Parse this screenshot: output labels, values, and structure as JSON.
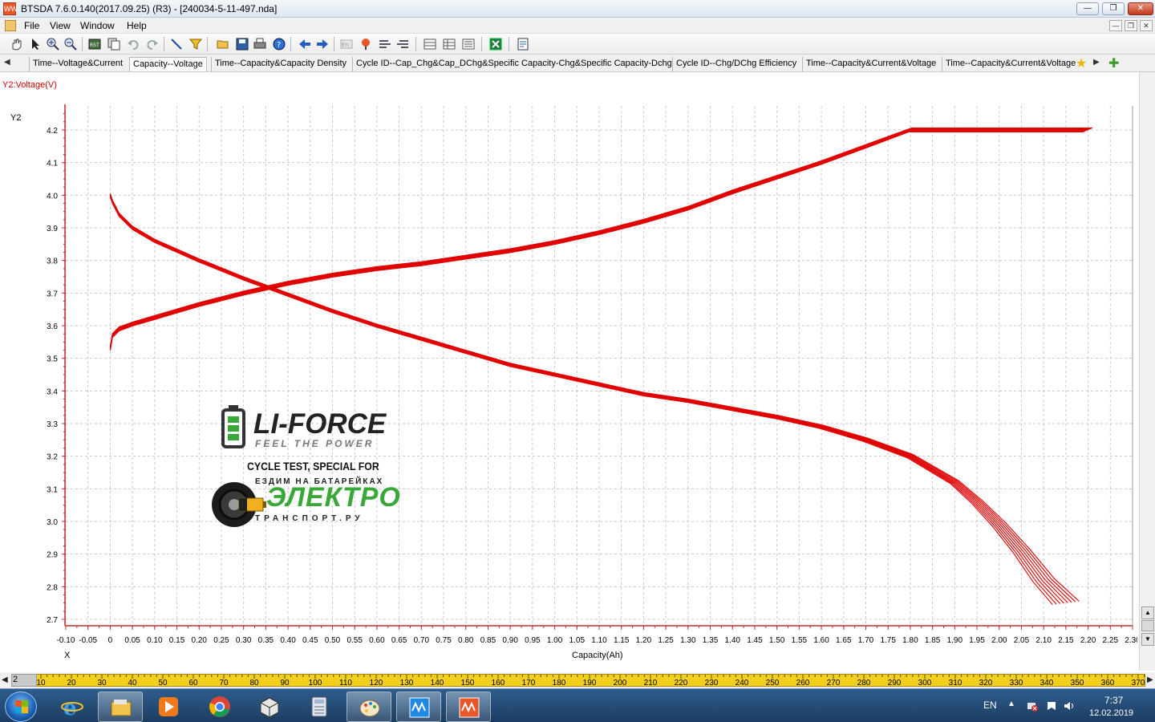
{
  "window": {
    "title": "BTSDA 7.6.0.140(2017.09.25) (R3) - [240034-5-11-497.nda]",
    "minimize_glyph": "—",
    "restore_glyph": "❐",
    "close_glyph": "✕",
    "app_icon_text": "WW"
  },
  "menu": {
    "items": [
      "File",
      "View",
      "Window",
      "Help"
    ],
    "mdi_minimize": "—",
    "mdi_restore": "❐",
    "mdi_close": "✕"
  },
  "toolbar": {
    "icons": [
      "hand-pan-icon",
      "pointer-icon",
      "zoom-in-icon",
      "zoom-out-icon",
      "rst-icon",
      "copy-icon",
      "undo-icon",
      "redo-icon",
      "line-tool-icon",
      "filter-icon",
      "open-folder-icon",
      "save-icon",
      "print-icon",
      "help-icon",
      "back-icon",
      "forward-icon",
      "language-icon",
      "marker-icon",
      "align-left-icon",
      "align-right-icon",
      "table-icon",
      "table-alt-icon",
      "table-list-icon",
      "excel-export-icon",
      "report-icon"
    ]
  },
  "tabs": {
    "items": [
      "Time--Voltage&Current",
      "Capacity--Voltage",
      "Time--Capacity&Capacity Density",
      "Cycle ID--Cap_Chg&Cap_DChg&Specific Capacity-Chg&Specific Capacity-Dchg",
      "Cycle ID--Chg/DChg Efficiency",
      "Time--Capacity&Current&Voltage",
      "Time--Capacity&Current&Voltage"
    ],
    "active_index": 1,
    "left_arrow": "◀",
    "right_arrow": "▶"
  },
  "chart_data": {
    "type": "line",
    "title": "",
    "series_header": "Y2:Voltage(V)",
    "ylabel": "Y2",
    "xlabel": "Capacity(Ah)",
    "x_axis_marker": "X",
    "xlim": [
      -0.1,
      2.3
    ],
    "ylim": [
      2.7,
      4.2
    ],
    "x_ticks": [
      "-0.10",
      "-0.05",
      "0",
      "0.05",
      "0.10",
      "0.15",
      "0.20",
      "0.25",
      "0.30",
      "0.35",
      "0.40",
      "0.45",
      "0.50",
      "0.55",
      "0.60",
      "0.65",
      "0.70",
      "0.75",
      "0.80",
      "0.85",
      "0.90",
      "0.95",
      "1.00",
      "1.05",
      "1.10",
      "1.15",
      "1.20",
      "1.25",
      "1.30",
      "1.35",
      "1.40",
      "1.45",
      "1.50",
      "1.55",
      "1.60",
      "1.65",
      "1.70",
      "1.75",
      "1.80",
      "1.85",
      "1.90",
      "1.95",
      "2.00",
      "2.05",
      "2.10",
      "2.15",
      "2.20",
      "2.25",
      "2.30"
    ],
    "y_ticks": [
      "4.2",
      "4.1",
      "4.0",
      "3.9",
      "3.8",
      "3.7",
      "3.6",
      "3.5",
      "3.4",
      "3.3",
      "3.2",
      "3.1",
      "3.0",
      "2.9",
      "2.8",
      "2.7"
    ],
    "grid": true,
    "series_color": "#e00000",
    "charge_curve": {
      "x": [
        0,
        0.005,
        0.02,
        0.05,
        0.1,
        0.15,
        0.2,
        0.3,
        0.4,
        0.5,
        0.6,
        0.7,
        0.8,
        0.9,
        1.0,
        1.1,
        1.2,
        1.3,
        1.4,
        1.5,
        1.6,
        1.7,
        1.75,
        1.8,
        1.85,
        1.9,
        2.0,
        2.1,
        2.2
      ],
      "y": [
        3.53,
        3.57,
        3.59,
        3.605,
        3.625,
        3.645,
        3.665,
        3.7,
        3.73,
        3.755,
        3.775,
        3.79,
        3.81,
        3.83,
        3.855,
        3.885,
        3.92,
        3.96,
        4.01,
        4.055,
        4.1,
        4.15,
        4.175,
        4.2,
        4.2,
        4.2,
        4.2,
        4.2,
        4.2
      ]
    },
    "discharge_curve": {
      "x": [
        0,
        0.005,
        0.02,
        0.05,
        0.1,
        0.2,
        0.3,
        0.4,
        0.5,
        0.6,
        0.7,
        0.8,
        0.9,
        1.0,
        1.1,
        1.2,
        1.3,
        1.4,
        1.5,
        1.6,
        1.7,
        1.8,
        1.9,
        1.95,
        2.0,
        2.05,
        2.1,
        2.15
      ],
      "y": [
        4.0,
        3.98,
        3.94,
        3.9,
        3.86,
        3.8,
        3.745,
        3.695,
        3.645,
        3.6,
        3.56,
        3.52,
        3.48,
        3.45,
        3.42,
        3.39,
        3.37,
        3.345,
        3.32,
        3.29,
        3.25,
        3.2,
        3.12,
        3.06,
        2.99,
        2.91,
        2.82,
        2.75
      ]
    },
    "cycles": 8
  },
  "watermark": {
    "logo_main": "LI-FORCE",
    "logo_tagline": "FEEL THE POWER",
    "special_text": "CYCLE TEST, SPECIAL FOR",
    "partner_line1": "ЕЗДИМ НА БАТАРЕЙКАХ",
    "partner_main": "ЭЛЕКТРО",
    "partner_line3": "ТРАНСПОРТ.РУ"
  },
  "scrollbar": {
    "up_glyph": "▲",
    "down_glyph": "▼"
  },
  "ruler": {
    "position": "2",
    "ticks": [
      "10",
      "20",
      "30",
      "40",
      "50",
      "60",
      "70",
      "80",
      "90",
      "100",
      "110",
      "120",
      "130",
      "140",
      "150",
      "160",
      "170",
      "180",
      "190",
      "200",
      "210",
      "220",
      "230",
      "240",
      "250",
      "260",
      "270",
      "280",
      "290",
      "300",
      "310",
      "320",
      "330",
      "340",
      "350",
      "360",
      "370"
    ],
    "left_arrow": "◀",
    "right_arrow": "▶"
  },
  "taskbar": {
    "apps": [
      "internet-explorer-icon",
      "file-explorer-icon",
      "media-player-icon",
      "chrome-icon",
      "package-icon",
      "calculator-icon",
      "paint-icon",
      "btsda-blue-icon",
      "btsda-orange-icon"
    ],
    "language": "EN",
    "time": "7:37",
    "date": "12.02.2019",
    "colors": {
      "accent": "#e8562a",
      "blue_app": "#1e88e5"
    }
  }
}
